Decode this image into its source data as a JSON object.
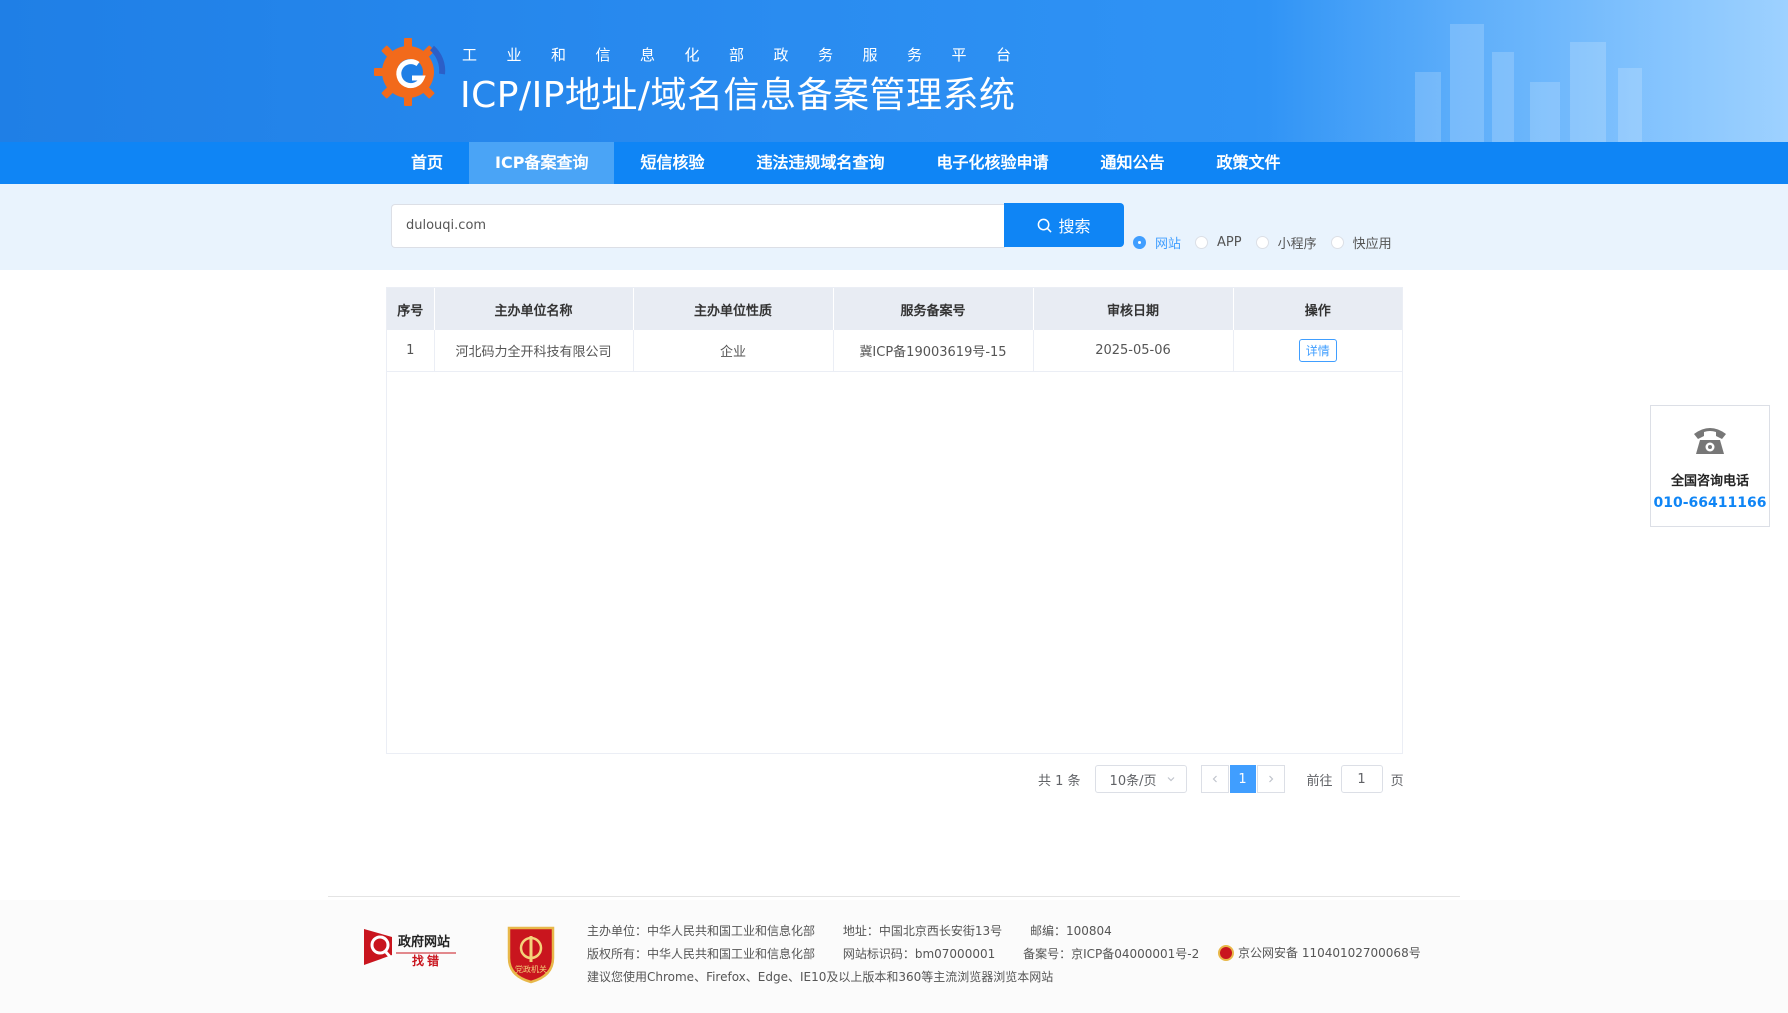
{
  "header": {
    "subtitle": "工业和信息化部政务服务平台",
    "title": "ICP/IP地址/域名信息备案管理系统"
  },
  "nav": {
    "items": [
      "首页",
      "ICP备案查询",
      "短信核验",
      "违法违规域名查询",
      "电子化核验申请",
      "通知公告",
      "政策文件"
    ],
    "active_index": 1
  },
  "search": {
    "value": "dulouqi.com",
    "button_label": "搜索",
    "radios": [
      "网站",
      "APP",
      "小程序",
      "快应用"
    ],
    "selected": "网站"
  },
  "table": {
    "headers": [
      "序号",
      "主办单位名称",
      "主办单位性质",
      "服务备案号",
      "审核日期",
      "操作"
    ],
    "rows": [
      [
        "1",
        "河北码力全开科技有限公司",
        "企业",
        "冀ICP备19003619号-15",
        "2025-05-06",
        "详情"
      ]
    ]
  },
  "pagination": {
    "total": "共 1 条",
    "page_size": "10条/页",
    "current_page": "1",
    "goto_label": "前往",
    "goto_value": "1",
    "page_suffix": "页",
    "prev_icon": "chevron-left-icon",
    "next_icon": "chevron-right-icon"
  },
  "side_contact": {
    "label": "全国咨询电话",
    "phone": "010-66411166",
    "icon": "telephone-icon"
  },
  "footer": {
    "gov_logo_text_top": "政府网站",
    "gov_logo_text_bottom": "找错",
    "badge_text": "党政机关",
    "line1": [
      "主办单位：中华人民共和国工业和信息化部",
      "地址：中国北京西长安街13号",
      "邮编：100804"
    ],
    "line2": [
      "版权所有：中华人民共和国工业和信息化部",
      "网站标识码：bm07000001",
      "备案号：京ICP备04000001号-2"
    ],
    "police_record": "京公网安备 11040102700068号",
    "line3": "建议您使用Chrome、Firefox、Edge、IE10及以上版本和360等主流浏览器浏览本网站"
  },
  "colors": {
    "primary": "#0f85f5",
    "nav_active": "#4aa4f6",
    "link": "#409eff",
    "search_band": "#e9f3fd",
    "table_header": "#e8ecf3"
  }
}
